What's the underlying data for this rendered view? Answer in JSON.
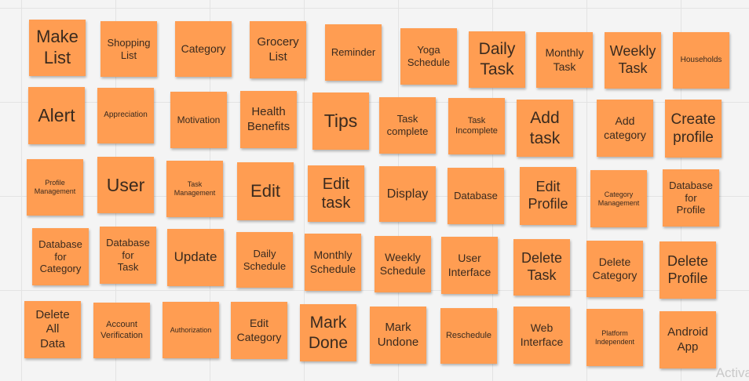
{
  "board": {
    "note_color": "#ff9d52",
    "notes": [
      "Make\nList",
      "Shopping\nList",
      "Category",
      "Grocery\nList",
      "Reminder",
      "Yoga\nSchedule",
      "Daily\nTask",
      "Monthly\nTask",
      "Weekly\nTask",
      "Households",
      "Alert",
      "Appreciation",
      "Motivation",
      "Health\nBenefits",
      "Tips",
      "Task\ncomplete",
      "Task\nIncomplete",
      "Add\ntask",
      "Add\ncategory",
      "Create\nprofile",
      "Profile\nManagement",
      "User",
      "Task\nManagement",
      "Edit",
      "Edit\ntask",
      "Display",
      "Database",
      "Edit\nProfile",
      "Category\nManagement",
      "Database\nfor\nProfile",
      "Database\nfor\nCategory",
      "Database\nfor\nTask",
      "Update",
      "Daily\nSchedule",
      "Monthly\nSchedule",
      "Weekly\nSchedule",
      "User\nInterface",
      "Delete\nTask",
      "Delete\nCategory",
      "Delete\nProfile",
      "Delete\nAll\nData",
      "Account\nVerification",
      "Authorization",
      "Edit\nCategory",
      "Mark\nDone",
      "Mark\nUndone",
      "Reschedule",
      "Web\nInterface",
      "Platform\nIndependent",
      "Android\nApp"
    ]
  },
  "watermark": "Activa"
}
